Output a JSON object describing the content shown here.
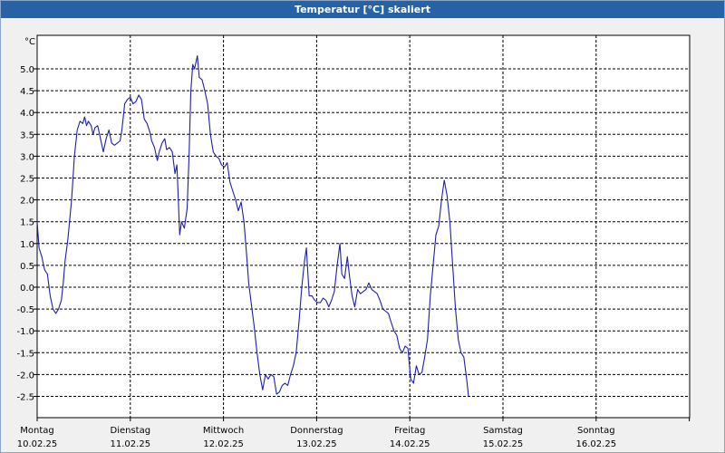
{
  "window": {
    "title": "Temperatur [°C] skaliert"
  },
  "chart_data": {
    "type": "line",
    "title": "Temperatur [°C] skaliert",
    "ylabel": "°C",
    "ylim": [
      -2.5,
      5.0
    ],
    "y_ticks": [
      "5.0",
      "4.5",
      "4.0",
      "3.5",
      "3.0",
      "2.5",
      "2.0",
      "1.5",
      "1.0",
      "0.5",
      "0.0",
      "-0.5",
      "-1.0",
      "-1.5",
      "-2.0",
      "-2.5"
    ],
    "y_tick_values": [
      5.0,
      4.5,
      4.0,
      3.5,
      3.0,
      2.5,
      2.0,
      1.5,
      1.0,
      0.5,
      0.0,
      -0.5,
      -1.0,
      -1.5,
      -2.0,
      -2.5
    ],
    "x_unit": "days",
    "xlim": [
      0,
      7
    ],
    "days": [
      {
        "name": "Montag",
        "date": "10.02.25"
      },
      {
        "name": "Dienstag",
        "date": "11.02.25"
      },
      {
        "name": "Mittwoch",
        "date": "12.02.25"
      },
      {
        "name": "Donnerstag",
        "date": "13.02.25"
      },
      {
        "name": "Freitag",
        "date": "14.02.25"
      },
      {
        "name": "Samstag",
        "date": "15.02.25"
      },
      {
        "name": "Sonntag",
        "date": "16.02.25"
      }
    ],
    "grid": true,
    "line_color": "#1f1fa8",
    "series": [
      {
        "points": [
          [
            0.0,
            1.5
          ],
          [
            0.02,
            0.9
          ],
          [
            0.05,
            0.7
          ],
          [
            0.08,
            0.4
          ],
          [
            0.11,
            0.3
          ],
          [
            0.14,
            -0.2
          ],
          [
            0.17,
            -0.5
          ],
          [
            0.2,
            -0.6
          ],
          [
            0.23,
            -0.5
          ],
          [
            0.26,
            -0.3
          ],
          [
            0.28,
            0.1
          ],
          [
            0.3,
            0.6
          ],
          [
            0.33,
            1.1
          ],
          [
            0.37,
            2.0
          ],
          [
            0.4,
            3.0
          ],
          [
            0.43,
            3.6
          ],
          [
            0.46,
            3.8
          ],
          [
            0.49,
            3.75
          ],
          [
            0.51,
            3.9
          ],
          [
            0.53,
            3.7
          ],
          [
            0.55,
            3.8
          ],
          [
            0.58,
            3.7
          ],
          [
            0.6,
            3.5
          ],
          [
            0.62,
            3.65
          ],
          [
            0.65,
            3.7
          ],
          [
            0.68,
            3.4
          ],
          [
            0.71,
            3.1
          ],
          [
            0.74,
            3.4
          ],
          [
            0.77,
            3.6
          ],
          [
            0.8,
            3.3
          ],
          [
            0.83,
            3.25
          ],
          [
            0.86,
            3.3
          ],
          [
            0.89,
            3.35
          ],
          [
            0.91,
            3.6
          ],
          [
            0.94,
            4.2
          ],
          [
            0.97,
            4.3
          ],
          [
            1.0,
            4.35
          ],
          [
            1.03,
            4.2
          ],
          [
            1.06,
            4.25
          ],
          [
            1.09,
            4.4
          ],
          [
            1.12,
            4.3
          ],
          [
            1.15,
            3.85
          ],
          [
            1.18,
            3.75
          ],
          [
            1.21,
            3.55
          ],
          [
            1.23,
            3.35
          ],
          [
            1.26,
            3.2
          ],
          [
            1.29,
            2.9
          ],
          [
            1.31,
            3.1
          ],
          [
            1.34,
            3.3
          ],
          [
            1.37,
            3.4
          ],
          [
            1.39,
            3.15
          ],
          [
            1.42,
            3.2
          ],
          [
            1.45,
            3.1
          ],
          [
            1.48,
            2.6
          ],
          [
            1.5,
            2.8
          ],
          [
            1.51,
            2.3
          ],
          [
            1.53,
            1.2
          ],
          [
            1.55,
            1.5
          ],
          [
            1.58,
            1.35
          ],
          [
            1.61,
            1.8
          ],
          [
            1.63,
            3.0
          ],
          [
            1.65,
            4.5
          ],
          [
            1.67,
            5.1
          ],
          [
            1.69,
            5.0
          ],
          [
            1.72,
            5.3
          ],
          [
            1.74,
            4.8
          ],
          [
            1.77,
            4.75
          ],
          [
            1.8,
            4.5
          ],
          [
            1.83,
            4.2
          ],
          [
            1.86,
            3.5
          ],
          [
            1.89,
            3.1
          ],
          [
            1.92,
            3.0
          ],
          [
            1.95,
            2.95
          ],
          [
            1.98,
            2.8
          ],
          [
            2.01,
            2.75
          ],
          [
            2.04,
            2.85
          ],
          [
            2.07,
            2.4
          ],
          [
            2.1,
            2.2
          ],
          [
            2.13,
            2.0
          ],
          [
            2.16,
            1.75
          ],
          [
            2.19,
            1.95
          ],
          [
            2.22,
            1.5
          ],
          [
            2.25,
            0.7
          ],
          [
            2.27,
            0.1
          ],
          [
            2.3,
            -0.4
          ],
          [
            2.33,
            -0.9
          ],
          [
            2.36,
            -1.5
          ],
          [
            2.39,
            -2.0
          ],
          [
            2.42,
            -2.35
          ],
          [
            2.45,
            -2.0
          ],
          [
            2.48,
            -2.1
          ],
          [
            2.51,
            -2.0
          ],
          [
            2.54,
            -2.05
          ],
          [
            2.57,
            -2.45
          ],
          [
            2.6,
            -2.4
          ],
          [
            2.63,
            -2.25
          ],
          [
            2.66,
            -2.2
          ],
          [
            2.69,
            -2.25
          ],
          [
            2.72,
            -2.0
          ],
          [
            2.75,
            -1.8
          ],
          [
            2.78,
            -1.5
          ],
          [
            2.81,
            -0.8
          ],
          [
            2.84,
            0.0
          ],
          [
            2.87,
            0.6
          ],
          [
            2.89,
            0.9
          ],
          [
            2.92,
            -0.2
          ],
          [
            2.95,
            -0.2
          ],
          [
            2.98,
            -0.3
          ],
          [
            3.01,
            -0.35
          ],
          [
            3.04,
            -0.35
          ],
          [
            3.07,
            -0.25
          ],
          [
            3.1,
            -0.3
          ],
          [
            3.13,
            -0.45
          ],
          [
            3.16,
            -0.3
          ],
          [
            3.19,
            -0.1
          ],
          [
            3.22,
            0.5
          ],
          [
            3.25,
            1.0
          ],
          [
            3.27,
            0.3
          ],
          [
            3.3,
            0.2
          ],
          [
            3.33,
            0.7
          ],
          [
            3.35,
            0.3
          ],
          [
            3.38,
            -0.2
          ],
          [
            3.41,
            -0.45
          ],
          [
            3.44,
            -0.05
          ],
          [
            3.47,
            -0.15
          ],
          [
            3.5,
            -0.1
          ],
          [
            3.53,
            -0.05
          ],
          [
            3.56,
            0.1
          ],
          [
            3.59,
            -0.05
          ],
          [
            3.62,
            -0.1
          ],
          [
            3.65,
            -0.15
          ],
          [
            3.68,
            -0.3
          ],
          [
            3.71,
            -0.5
          ],
          [
            3.74,
            -0.55
          ],
          [
            3.77,
            -0.6
          ],
          [
            3.8,
            -0.8
          ],
          [
            3.83,
            -1.0
          ],
          [
            3.86,
            -1.1
          ],
          [
            3.89,
            -1.4
          ],
          [
            3.92,
            -1.5
          ],
          [
            3.95,
            -1.35
          ],
          [
            3.98,
            -1.4
          ],
          [
            4.01,
            -2.1
          ],
          [
            4.04,
            -2.2
          ],
          [
            4.07,
            -1.8
          ],
          [
            4.1,
            -2.0
          ],
          [
            4.13,
            -1.95
          ],
          [
            4.16,
            -1.6
          ],
          [
            4.19,
            -1.2
          ],
          [
            4.22,
            -0.2
          ],
          [
            4.25,
            0.5
          ],
          [
            4.28,
            1.2
          ],
          [
            4.31,
            1.4
          ],
          [
            4.34,
            2.0
          ],
          [
            4.37,
            2.45
          ],
          [
            4.4,
            2.1
          ],
          [
            4.43,
            1.5
          ],
          [
            4.46,
            0.5
          ],
          [
            4.49,
            -0.5
          ],
          [
            4.52,
            -1.2
          ],
          [
            4.55,
            -1.5
          ],
          [
            4.58,
            -1.6
          ],
          [
            4.61,
            -2.1
          ],
          [
            4.63,
            -2.5
          ]
        ]
      }
    ]
  }
}
